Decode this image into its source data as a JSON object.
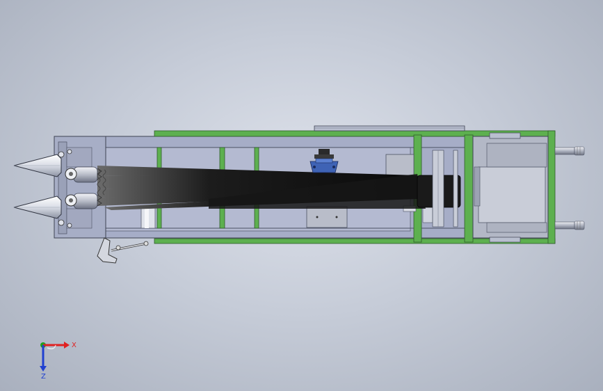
{
  "viewport": {
    "background_top": "#dde1ea",
    "background_bottom": "#a9b0be"
  },
  "model": {
    "frame_color": "#5db04f",
    "body_color": "#a6adc7",
    "belt_color": "#111111",
    "motor_color": "#3f63b5",
    "cone_color": "#e9ecf2"
  },
  "triad": {
    "x_label": "X",
    "z_label": "Z",
    "x_color": "#e02020",
    "z_color": "#2040d0",
    "y_color": "#20a020"
  }
}
